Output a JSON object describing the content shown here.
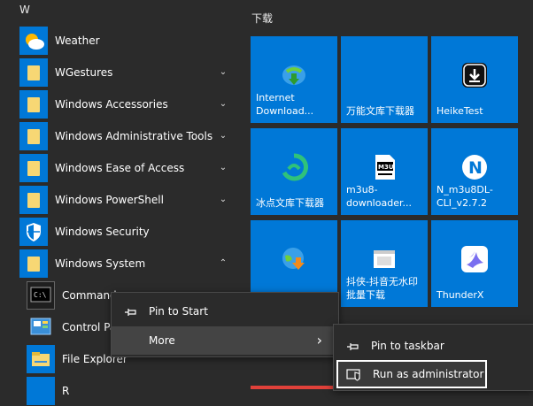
{
  "applist": {
    "letter": "W",
    "items": [
      {
        "label": "Weather",
        "chevron": ""
      },
      {
        "label": "WGestures",
        "chevron": "⌄"
      },
      {
        "label": "Windows Accessories",
        "chevron": "⌄"
      },
      {
        "label": "Windows Administrative Tools",
        "chevron": "⌄"
      },
      {
        "label": "Windows Ease of Access",
        "chevron": "⌄"
      },
      {
        "label": "Windows PowerShell",
        "chevron": "⌄"
      },
      {
        "label": "Windows Security",
        "chevron": ""
      },
      {
        "label": "Windows System",
        "chevron": "⌃"
      }
    ],
    "subitems": [
      {
        "label": "Command"
      },
      {
        "label": "Control Pa"
      },
      {
        "label": "File Explorer"
      },
      {
        "label": "R"
      }
    ]
  },
  "tiles": {
    "group_title": "下载",
    "items": [
      {
        "label": "Internet Download..."
      },
      {
        "label": "万能文库下载器"
      },
      {
        "label": "HeikeTest"
      },
      {
        "label": "冰点文库下载器"
      },
      {
        "label": "m3u8-downloader..."
      },
      {
        "label": "N_m3u8DL-CLI_v2.7.2"
      },
      {
        "label": ""
      },
      {
        "label": "抖侠-抖音无水印批量下载"
      },
      {
        "label": "ThunderX"
      }
    ]
  },
  "context_menu": {
    "pin_to_start": "Pin to Start",
    "more": "More",
    "more_arrow": "›"
  },
  "submenu": {
    "pin_to_taskbar": "Pin to taskbar",
    "run_as_admin": "Run as administrator"
  },
  "colors": {
    "tile_blue": "#0078d7",
    "background": "#2b2b2b",
    "folder": "#f7d774"
  }
}
